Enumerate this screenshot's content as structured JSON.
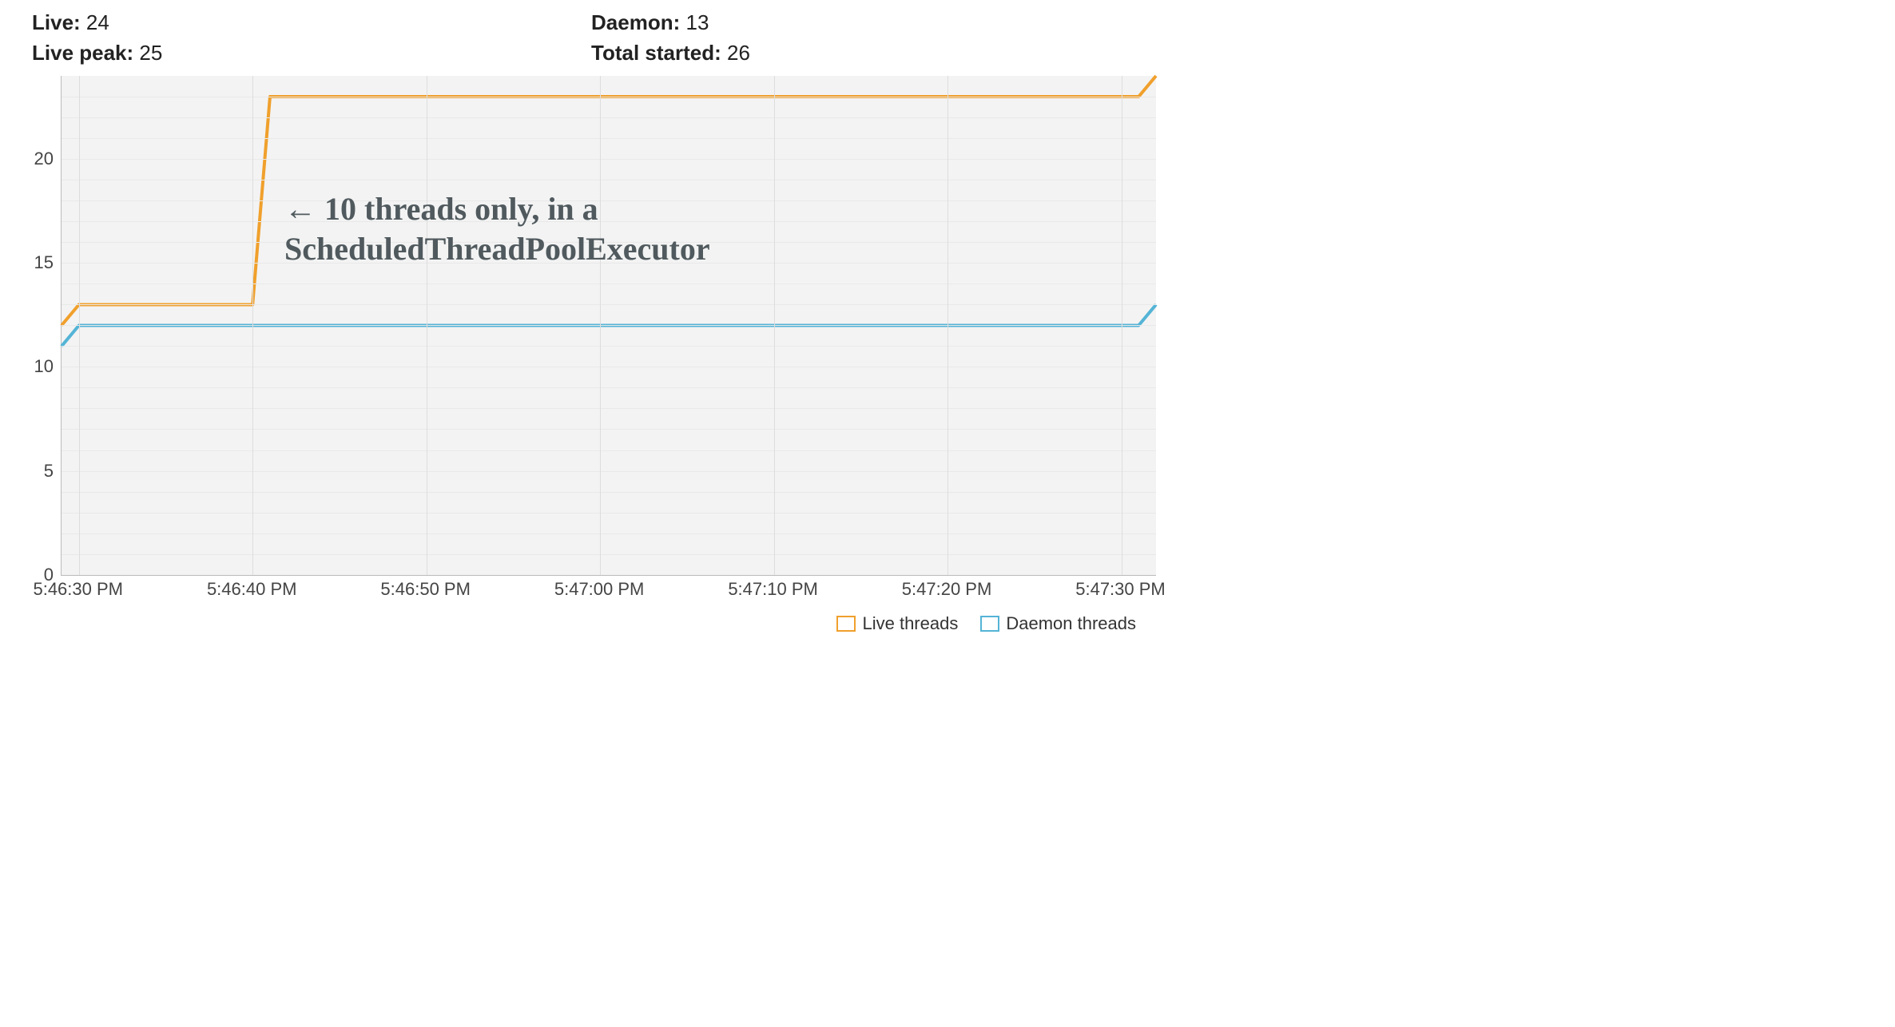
{
  "stats": {
    "live_label": "Live:",
    "live_value": "24",
    "live_peak_label": "Live peak:",
    "live_peak_value": "25",
    "daemon_label": "Daemon:",
    "daemon_value": "13",
    "total_started_label": "Total started:",
    "total_started_value": "26"
  },
  "legend": {
    "live": "Live threads",
    "daemon": "Daemon threads"
  },
  "annotation": {
    "text": "← 10 threads only, in a\nScheduledThreadPoolExecutor"
  },
  "colors": {
    "live": "#f0a02c",
    "daemon": "#54b4d6",
    "annotation": "#505a5e"
  },
  "chart_data": {
    "type": "line",
    "xlabel": "",
    "ylabel": "",
    "ylim": [
      0,
      24
    ],
    "y_ticks": [
      0,
      5,
      10,
      15,
      20
    ],
    "x_ticks": [
      "5:46:30 PM",
      "5:46:40 PM",
      "5:46:50 PM",
      "5:47:00 PM",
      "5:47:10 PM",
      "5:47:20 PM",
      "5:47:30 PM"
    ],
    "x": [
      "5:46:29",
      "5:46:30",
      "5:46:40",
      "5:46:41",
      "5:47:31",
      "5:47:32"
    ],
    "series": [
      {
        "name": "Live threads",
        "values": [
          12,
          13,
          13,
          23,
          23,
          24
        ]
      },
      {
        "name": "Daemon threads",
        "values": [
          11,
          12,
          12,
          12,
          12,
          13
        ]
      }
    ]
  }
}
